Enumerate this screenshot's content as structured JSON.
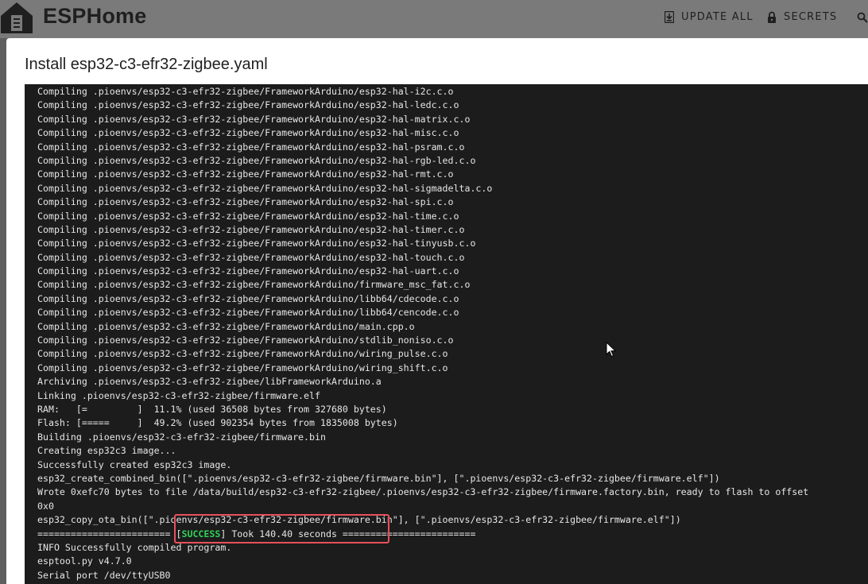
{
  "header": {
    "brand": "ESPHome",
    "update_all_label": "UPDATE ALL",
    "secrets_label": "SECRETS",
    "icons": {
      "logo": "esphome-house-logo",
      "update": "download-icon",
      "secrets": "lock-icon",
      "search": "search-icon"
    }
  },
  "dialog": {
    "title": "Install esp32-c3-efr32-zigbee.yaml"
  },
  "log": {
    "lines": [
      "Compiling .pioenvs/esp32-c3-efr32-zigbee/FrameworkArduino/esp32-hal-i2c.c.o",
      "Compiling .pioenvs/esp32-c3-efr32-zigbee/FrameworkArduino/esp32-hal-ledc.c.o",
      "Compiling .pioenvs/esp32-c3-efr32-zigbee/FrameworkArduino/esp32-hal-matrix.c.o",
      "Compiling .pioenvs/esp32-c3-efr32-zigbee/FrameworkArduino/esp32-hal-misc.c.o",
      "Compiling .pioenvs/esp32-c3-efr32-zigbee/FrameworkArduino/esp32-hal-psram.c.o",
      "Compiling .pioenvs/esp32-c3-efr32-zigbee/FrameworkArduino/esp32-hal-rgb-led.c.o",
      "Compiling .pioenvs/esp32-c3-efr32-zigbee/FrameworkArduino/esp32-hal-rmt.c.o",
      "Compiling .pioenvs/esp32-c3-efr32-zigbee/FrameworkArduino/esp32-hal-sigmadelta.c.o",
      "Compiling .pioenvs/esp32-c3-efr32-zigbee/FrameworkArduino/esp32-hal-spi.c.o",
      "Compiling .pioenvs/esp32-c3-efr32-zigbee/FrameworkArduino/esp32-hal-time.c.o",
      "Compiling .pioenvs/esp32-c3-efr32-zigbee/FrameworkArduino/esp32-hal-timer.c.o",
      "Compiling .pioenvs/esp32-c3-efr32-zigbee/FrameworkArduino/esp32-hal-tinyusb.c.o",
      "Compiling .pioenvs/esp32-c3-efr32-zigbee/FrameworkArduino/esp32-hal-touch.c.o",
      "Compiling .pioenvs/esp32-c3-efr32-zigbee/FrameworkArduino/esp32-hal-uart.c.o",
      "Compiling .pioenvs/esp32-c3-efr32-zigbee/FrameworkArduino/firmware_msc_fat.c.o",
      "Compiling .pioenvs/esp32-c3-efr32-zigbee/FrameworkArduino/libb64/cdecode.c.o",
      "Compiling .pioenvs/esp32-c3-efr32-zigbee/FrameworkArduino/libb64/cencode.c.o",
      "Compiling .pioenvs/esp32-c3-efr32-zigbee/FrameworkArduino/main.cpp.o",
      "Compiling .pioenvs/esp32-c3-efr32-zigbee/FrameworkArduino/stdlib_noniso.c.o",
      "Compiling .pioenvs/esp32-c3-efr32-zigbee/FrameworkArduino/wiring_pulse.c.o",
      "Compiling .pioenvs/esp32-c3-efr32-zigbee/FrameworkArduino/wiring_shift.c.o",
      "Archiving .pioenvs/esp32-c3-efr32-zigbee/libFrameworkArduino.a",
      "Linking .pioenvs/esp32-c3-efr32-zigbee/firmware.elf",
      "RAM:   [=         ]  11.1% (used 36508 bytes from 327680 bytes)",
      "Flash: [=====     ]  49.2% (used 902354 bytes from 1835008 bytes)",
      "Building .pioenvs/esp32-c3-efr32-zigbee/firmware.bin",
      "Creating esp32c3 image...",
      "Successfully created esp32c3 image.",
      "esp32_create_combined_bin([\".pioenvs/esp32-c3-efr32-zigbee/firmware.bin\"], [\".pioenvs/esp32-c3-efr32-zigbee/firmware.elf\"])",
      "Wrote 0xefc70 bytes to file /data/build/esp32-c3-efr32-zigbee/.pioenvs/esp32-c3-efr32-zigbee/firmware.factory.bin, ready to flash to offset",
      "0x0",
      "esp32_copy_ota_bin([\".pioenvs/esp32-c3-efr32-zigbee/firmware.bin\"], [\".pioenvs/esp32-c3-efr32-zigbee/firmware.elf\"])"
    ],
    "success_line": {
      "prefix": "======================== [",
      "tag": "SUCCESS",
      "suffix": "] Took 140.40 seconds ========================"
    },
    "tail_lines": [
      "INFO Successfully compiled program.",
      "esptool.py v4.7.0",
      "Serial port /dev/ttyUSB0"
    ],
    "colors": {
      "background": "#1c1c1c",
      "text": "#e6e6e6",
      "success": "#30d158",
      "highlight": "#e8505b"
    }
  }
}
